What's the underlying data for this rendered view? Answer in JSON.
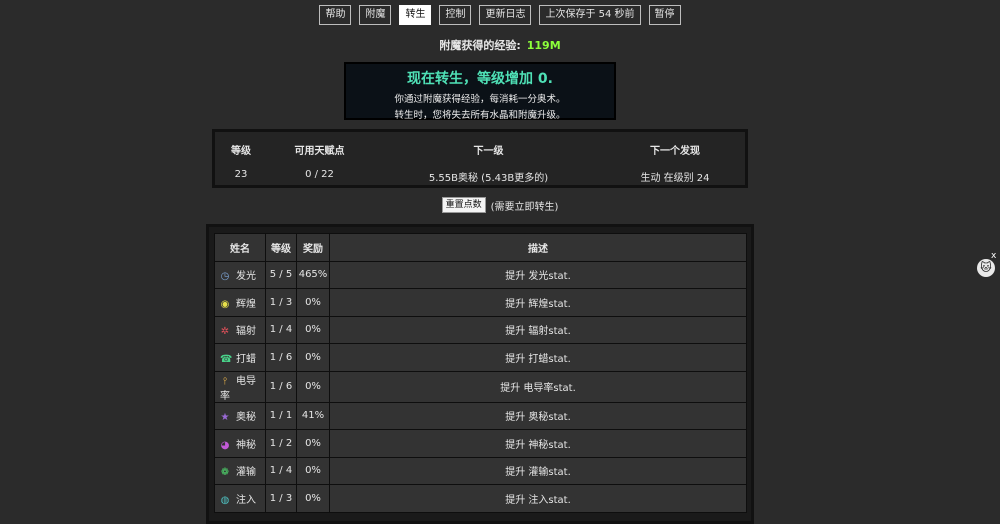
{
  "nav": [
    {
      "label": "帮助",
      "active": false
    },
    {
      "label": "附魔",
      "active": false
    },
    {
      "label": "转生",
      "active": true
    },
    {
      "label": "控制",
      "active": false
    },
    {
      "label": "更新日志",
      "active": false
    },
    {
      "label": "上次保存于 54 秒前",
      "active": false
    },
    {
      "label": "暂停",
      "active": false
    }
  ],
  "exp": {
    "label": "附魔获得的经验:",
    "value": "119M"
  },
  "rebirth": {
    "title": "现在转生，等级增加 0.",
    "line1": "你通过附魔获得经验，每消耗一分奥术。",
    "line2": "转生时，您将失去所有水晶和附魔升级。"
  },
  "summary": {
    "headers": [
      "等级",
      "可用天赋点",
      "下一级",
      "下一个发现"
    ],
    "values": [
      "23",
      "0 / 22",
      "5.55B奥秘 (5.43B更多的)",
      "生动 在级别 24"
    ]
  },
  "reset": {
    "button": "重置点数",
    "note": "(需要立即转生)"
  },
  "table": {
    "headers": [
      "姓名",
      "等级",
      "奖励",
      "描述"
    ],
    "rows": [
      {
        "icon": "◷",
        "icon_name": "glow-icon",
        "color": "#7fa7d9",
        "name": "发光",
        "level": "5 / 5",
        "bonus": "465%",
        "desc": "提升 发光stat."
      },
      {
        "icon": "◉",
        "icon_name": "radiance-icon",
        "color": "#e6e04a",
        "name": "辉煌",
        "level": "1 / 3",
        "bonus": "0%",
        "desc": "提升 辉煌stat."
      },
      {
        "icon": "✲",
        "icon_name": "radiation-icon",
        "color": "#e2505a",
        "name": "辐射",
        "level": "1 / 4",
        "bonus": "0%",
        "desc": "提升 辐射stat."
      },
      {
        "icon": "☎",
        "icon_name": "yawn-icon",
        "color": "#49d38a",
        "name": "打蜡",
        "level": "1 / 6",
        "bonus": "0%",
        "desc": "提升 打蜡stat."
      },
      {
        "icon": "⫯",
        "icon_name": "conductivity-icon",
        "color": "#e9b34a",
        "name": "电导率",
        "level": "1 / 6",
        "bonus": "0%",
        "desc": "提升 电导率stat."
      },
      {
        "icon": "★",
        "icon_name": "arcane-icon",
        "color": "#9a6ad6",
        "name": "奥秘",
        "level": "1 / 1",
        "bonus": "41%",
        "desc": "提升 奥秘stat."
      },
      {
        "icon": "◕",
        "icon_name": "mystic-icon",
        "color": "#c35ad8",
        "name": "神秘",
        "level": "1 / 2",
        "bonus": "0%",
        "desc": "提升 神秘stat."
      },
      {
        "icon": "❁",
        "icon_name": "infusion-swirl-icon",
        "color": "#4ed36b",
        "name": "灌输",
        "level": "1 / 4",
        "bonus": "0%",
        "desc": "提升 灌输stat."
      },
      {
        "icon": "◍",
        "icon_name": "inject-icon",
        "color": "#4fc0c0",
        "name": "注入",
        "level": "1 / 3",
        "bonus": "0%",
        "desc": "提升 注入stat."
      }
    ]
  },
  "side": {
    "close": "x",
    "cat": "🐱"
  }
}
